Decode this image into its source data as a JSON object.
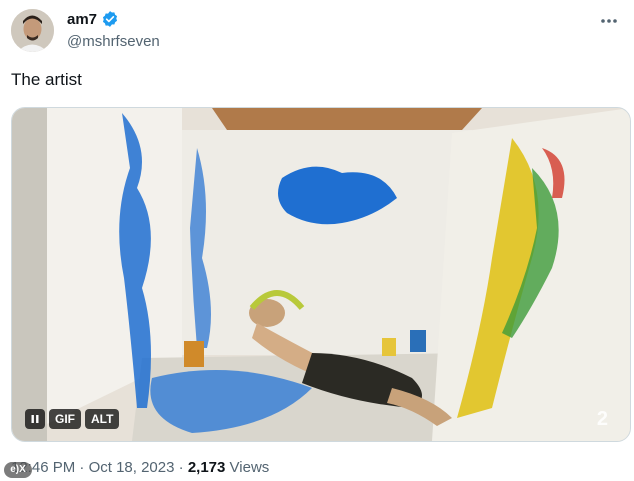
{
  "tweet": {
    "display_name": "am7",
    "handle": "@mshrfseven",
    "text": "The artist",
    "verified": true,
    "more_icon": "more-horizontal-icon"
  },
  "media": {
    "controls": {
      "pause_icon": "pause-icon",
      "gif_label": "GIF",
      "alt_label": "ALT"
    },
    "watermark_text": "2"
  },
  "meta": {
    "time": "12:46 PM",
    "separator1": "·",
    "date": "Oct 18, 2023",
    "separator2": "·",
    "views_count": "2,173",
    "views_label": "Views"
  },
  "overlay_logo": "e)X",
  "colors": {
    "text": "#0f1419",
    "secondary": "#536471",
    "verified_blue": "#1d9bf0",
    "paint_blue": "#1f6fd1",
    "paint_yellow": "#e0c21c"
  }
}
